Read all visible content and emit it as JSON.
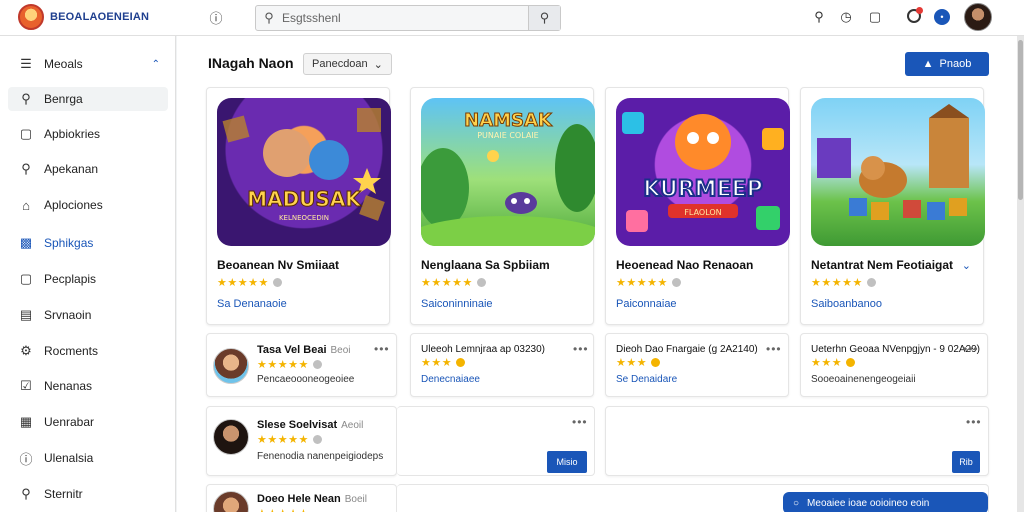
{
  "app": {
    "brand": "BEOALAOENEIAN"
  },
  "topbar": {
    "search_placeholder": "Esgtsshenl",
    "icons": [
      "info-icon",
      "search-icon",
      "clock-icon",
      "book-icon",
      "notification-icon",
      "help-icon"
    ]
  },
  "sidebar": {
    "items": [
      {
        "label": "Meoals",
        "icon": "menu-icon"
      },
      {
        "label": "Benrga",
        "icon": "search-icon"
      },
      {
        "label": "Apbiokries",
        "icon": "box-icon"
      },
      {
        "label": "Apekanan",
        "icon": "search-icon"
      },
      {
        "label": "Aplociones",
        "icon": "home-icon"
      },
      {
        "label": "Sphikgas",
        "icon": "chart-icon"
      },
      {
        "label": "Pecplapis",
        "icon": "box-icon"
      },
      {
        "label": "Srvnaoin",
        "icon": "list-icon"
      },
      {
        "label": "Rocments",
        "icon": "gear-icon"
      },
      {
        "label": "Nenanas",
        "icon": "check-icon"
      },
      {
        "label": "Uenrabar",
        "icon": "document-icon"
      },
      {
        "label": "Ulenalsia",
        "icon": "info-icon"
      },
      {
        "label": "Sternitr",
        "icon": "search-icon"
      }
    ]
  },
  "main": {
    "title": "INagah Naon",
    "filter_label": "Panecdoan",
    "primary_button": "Pnaob",
    "featured": [
      {
        "art_text": "MADUSAK",
        "art_sub": "KELNEOCEDIN",
        "title": "Beoanean Nv Smiiaat",
        "link": "Sa Denanaoie",
        "rating": 4
      },
      {
        "art_text": "NAMSAK",
        "art_sub": "PUNAIE COLAIE",
        "title": "Nenglaana Sa Spbiiam",
        "link": "Saiconinninaie",
        "rating": 4
      },
      {
        "art_text": "KURMEEP",
        "art_sub": "FLAOLON",
        "title": "Heoenead Nao Renaoan",
        "link": "Paiconnaiae",
        "rating": 4
      },
      {
        "art_text": "",
        "art_sub": "",
        "title": "Netantrat Nem Feotiaigat",
        "link": "Saiboanbanoo",
        "rating": 4
      }
    ],
    "rows": [
      {
        "name": "Tasa Vel Beai",
        "tag": "Beoi",
        "sub": "Pencaeoooneogeoiee",
        "rating": 5
      },
      {
        "name": "Uleeoh Lemnjraa ap 03230)",
        "sub": "Denecnaiaee",
        "rating": 4
      },
      {
        "name": "Dieoh Dao Fnargaie (g 2A2140)",
        "sub": "Se Denaidare",
        "rating": 4
      },
      {
        "name": "Ueterhn Geoaa NVenpgjyn - 9 02A29)",
        "sub": "Sooeoainenengeogeiaii",
        "rating": 4
      },
      {
        "name": "Slese Soelvisat",
        "tag": "Aeoil",
        "sub": "Fenenodia nanenpeigiodeps",
        "rating": 5
      },
      {
        "name": "Doeo Hele Nean",
        "tag": "Boeil",
        "rating": 5
      }
    ],
    "row_buttons": [
      "Misio",
      "Rib"
    ],
    "toast": "Meoaiee ioae ooioineo eoin"
  },
  "colors": {
    "accent": "#1a56b8",
    "star": "#f4b400"
  }
}
